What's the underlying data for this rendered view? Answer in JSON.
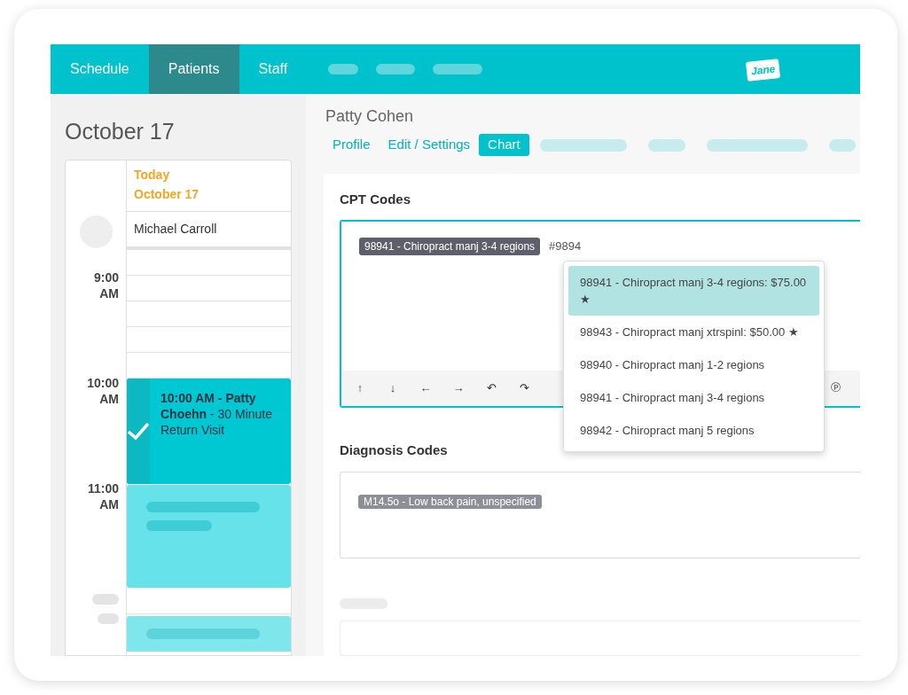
{
  "nav": {
    "logo": "Jane",
    "tabs": [
      {
        "label": "Schedule",
        "selected": false
      },
      {
        "label": "Patients",
        "selected": true
      },
      {
        "label": "Staff",
        "selected": false
      }
    ]
  },
  "calendar": {
    "title": "October 17",
    "day_label": "Today",
    "date_label": "October 17",
    "provider": "Michael Carroll",
    "times": [
      "9:00 AM",
      "10:00 AM",
      "11:00 AM"
    ],
    "appointment": {
      "text": "**10:00 AM - Patty Choehn** - 30 Minute Return Visit",
      "checked": true
    }
  },
  "patient": {
    "name": "Patty Cohen",
    "tabs": [
      {
        "label": "Profile",
        "selected": false
      },
      {
        "label": "Edit / Settings",
        "selected": false
      },
      {
        "label": "Chart",
        "selected": true
      }
    ]
  },
  "cpt": {
    "title": "CPT Codes",
    "tags": [
      "98941 - Chiropract manj 3-4 regions"
    ],
    "value": "#9894",
    "toolbar": [
      "↑",
      "↓",
      "←",
      "→",
      "↶",
      "↷"
    ],
    "toolbar_end": "℗",
    "suggestions": [
      {
        "label": "98941 - Chiropract manj 3-4 regions: $75.00 ★",
        "selected": true
      },
      {
        "label": "98943 - Chiropract manj xtrspinl: $50.00 ★",
        "selected": false
      },
      {
        "label": "98940 - Chiropract manj 1-2 regions",
        "selected": false
      },
      {
        "label": "98941 - Chiropract manj 3-4 regions",
        "selected": false
      },
      {
        "label": "98942 - Chiropract manj 5 regions",
        "selected": false
      }
    ]
  },
  "diagnosis": {
    "title": "Diagnosis Codes",
    "tags": [
      "M14.5o - Low back pain, unspecified"
    ]
  }
}
